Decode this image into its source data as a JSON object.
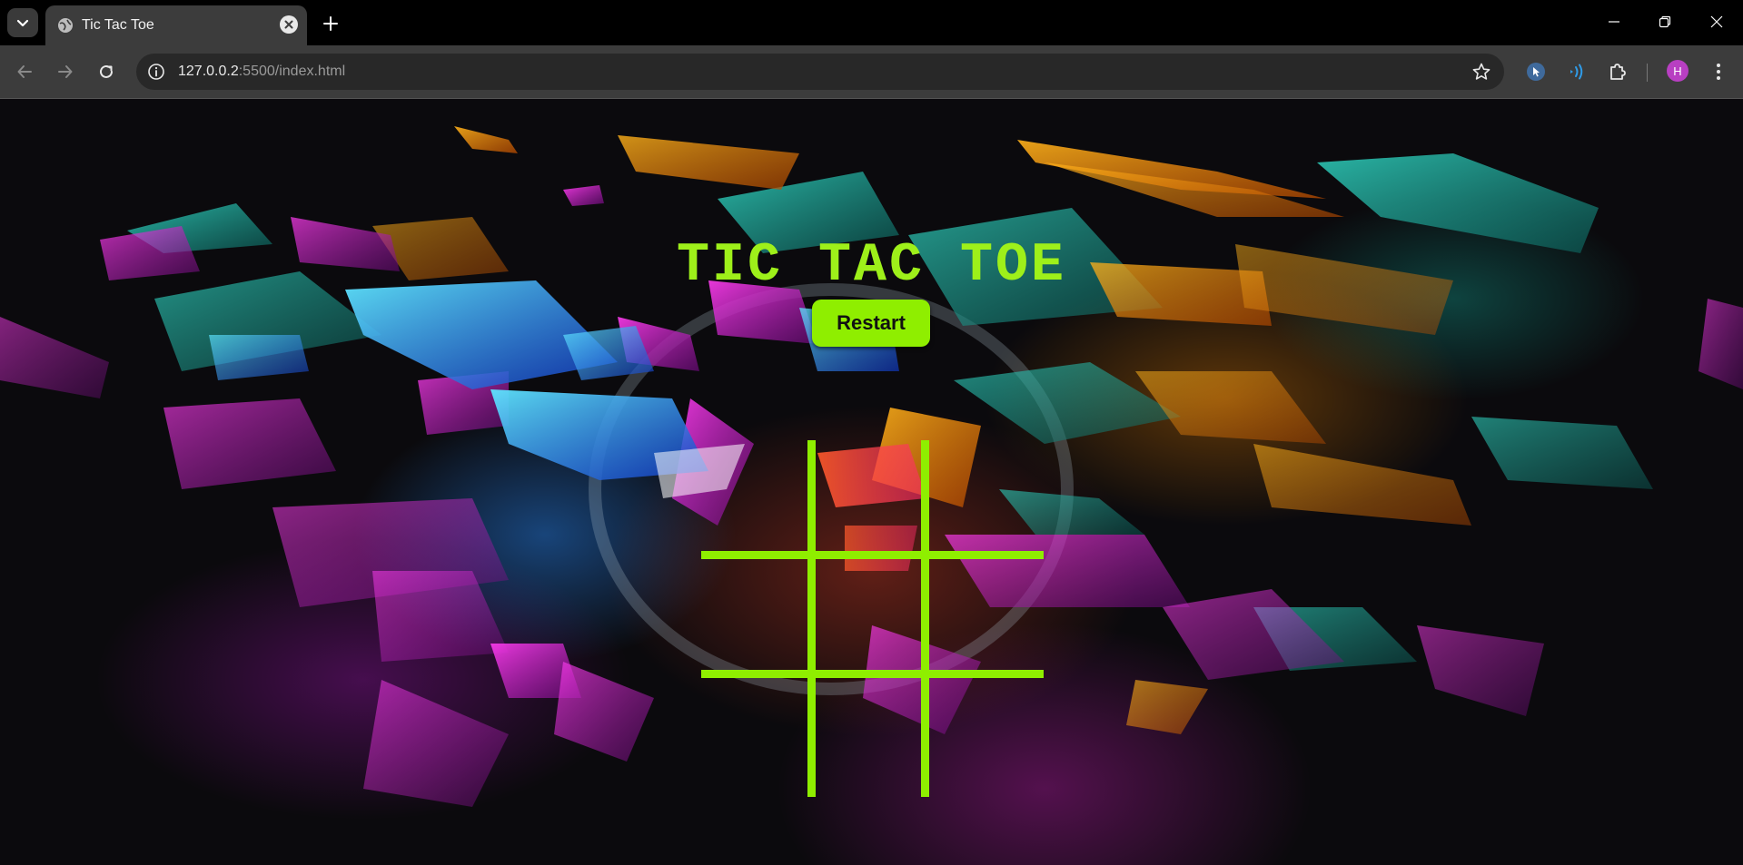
{
  "browser": {
    "tab": {
      "title": "Tic Tac Toe"
    },
    "toolbar": {
      "url_host": "127.0.0.2",
      "url_rest": ":5500/index.html"
    },
    "profile": {
      "initial": "H",
      "color": "#b83fc2"
    },
    "icons": [
      "tab-search-icon",
      "globe-icon",
      "close-icon",
      "plus-icon",
      "minimize-icon",
      "restore-icon",
      "window-close-icon",
      "back-arrow-icon",
      "forward-arrow-icon",
      "reload-icon",
      "info-icon",
      "star-icon",
      "cursor-extension-icon",
      "audio-extension-icon",
      "puzzle-icon",
      "kebab-menu-icon"
    ]
  },
  "page": {
    "title": "TIC TAC TOE",
    "restart_label": "Restart",
    "accent_color": "#8fee00",
    "board": {
      "cells": [
        "",
        "",
        "",
        "",
        "",
        "",
        "",
        "",
        ""
      ]
    }
  }
}
